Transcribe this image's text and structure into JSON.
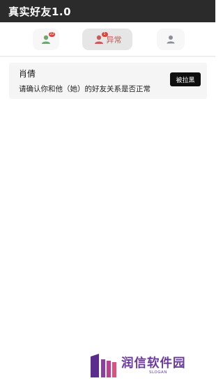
{
  "app": {
    "title": "真实好友1.0"
  },
  "tabs": [
    {
      "name": "friends",
      "label": "",
      "badge": "22",
      "icon": "user-group-icon",
      "color": "#6aa86e"
    },
    {
      "name": "abnormal",
      "label": "异常",
      "badge": "1",
      "icon": "user-icon",
      "color": "#c85b5b",
      "active": true
    },
    {
      "name": "profile",
      "label": "",
      "badge": "",
      "icon": "user-icon",
      "color": "#8a8f98"
    }
  ],
  "card": {
    "name": "肖倩",
    "message": "请确认你和他（她）的好友关系是否正常",
    "action_label": "被拉黑"
  },
  "branding": {
    "name": "润信软件园",
    "slogan": "SLOGAN"
  },
  "colors": {
    "header_bg": "#2b2b2b",
    "accent_red": "#c85b5b",
    "brand_purple": "#6a3a9c"
  }
}
